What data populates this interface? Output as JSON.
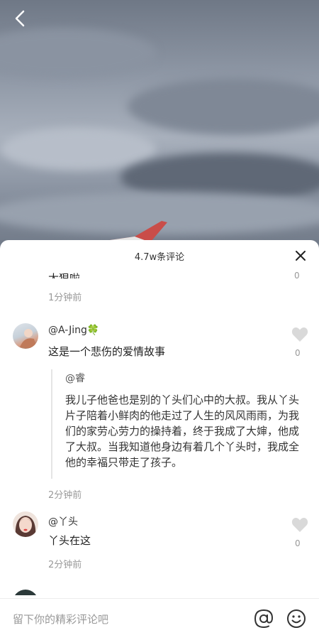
{
  "comments_header": {
    "title": "4.7w条评论"
  },
  "partial_comment": {
    "text": "太狠啦",
    "likes": "0",
    "time": "1分钟前"
  },
  "comments": [
    {
      "user": "@A-Jing🍀",
      "text": "这是一个悲伤的爱情故事",
      "likes": "0",
      "time": "2分钟前",
      "quote": {
        "user": "@睿",
        "text": "我儿子他爸也是别的丫头们心中的大叔。我从丫头片子陪着小鲜肉的他走过了人生的风风雨雨，为我们的家劳心劳力的操持着，终于我成了大婶，他成了大叔。当我知道他身边有着几个丫头时，我成全他的幸福只带走了孩子。"
      }
    },
    {
      "user": "@丫头",
      "text": "丫头在这",
      "likes": "0",
      "time": "2分钟前"
    }
  ],
  "input_bar": {
    "placeholder": "留下你的精彩评论吧"
  }
}
